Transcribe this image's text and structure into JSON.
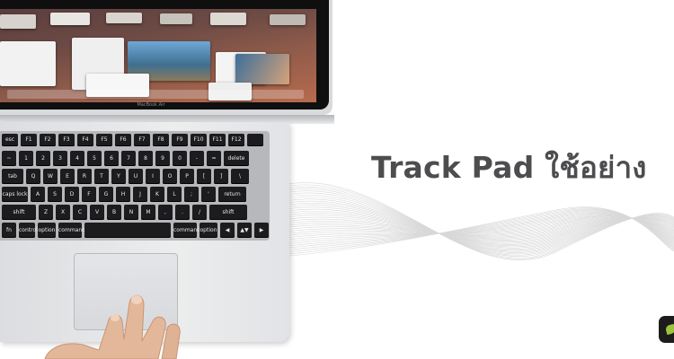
{
  "headline": "Track Pad ใช้อย่าง",
  "laptop": {
    "brand": "MacBook Air"
  },
  "keyboard": {
    "rows": [
      [
        "esc",
        "F1",
        "F2",
        "F3",
        "F4",
        "F5",
        "F6",
        "F7",
        "F8",
        "F9",
        "F10",
        "F11",
        "F12",
        ""
      ],
      [
        "~",
        "1",
        "2",
        "3",
        "4",
        "5",
        "6",
        "7",
        "8",
        "9",
        "0",
        "-",
        "=",
        "delete"
      ],
      [
        "tab",
        "Q",
        "W",
        "E",
        "R",
        "T",
        "Y",
        "U",
        "I",
        "O",
        "P",
        "[",
        "]",
        "\\"
      ],
      [
        "caps lock",
        "A",
        "S",
        "D",
        "F",
        "G",
        "H",
        "J",
        "K",
        "L",
        ";",
        "'",
        "return"
      ],
      [
        "shift",
        "Z",
        "X",
        "C",
        "V",
        "B",
        "N",
        "M",
        ",",
        ".",
        "/",
        "shift"
      ],
      [
        "fn",
        "control",
        "option",
        "command",
        "",
        "command",
        "option",
        "◀",
        "▲▼",
        "▶"
      ]
    ]
  },
  "colors": {
    "heading": "#4d4d4f",
    "keys": "#1c1c1e",
    "aluminum": "#e6e7e9",
    "logo_leaf": "#9bc53d"
  },
  "icons": {
    "logo": "leaf-icon"
  }
}
